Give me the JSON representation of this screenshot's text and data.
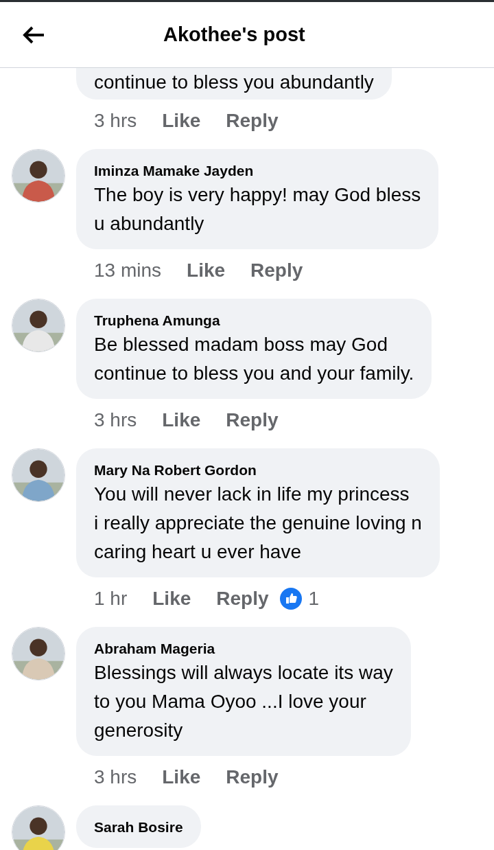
{
  "header": {
    "title": "Akothee's post"
  },
  "comments": [
    {
      "kind": "tail",
      "lines": [
        "continue to bless you abundantly"
      ],
      "time": "3 hrs",
      "like": "Like",
      "reply": "Reply"
    },
    {
      "kind": "full",
      "name": "Iminza Mamake Jayden",
      "lines": [
        "The boy is very happy! may God bless",
        "u abundantly"
      ],
      "time": "13 mins",
      "like": "Like",
      "reply": "Reply"
    },
    {
      "kind": "full",
      "name": "Truphena Amunga",
      "lines": [
        "Be blessed madam boss may God",
        "continue to bless you and your family."
      ],
      "time": "3 hrs",
      "like": "Like",
      "reply": "Reply"
    },
    {
      "kind": "full",
      "name": "Mary Na Robert Gordon",
      "lines": [
        "You will never lack in life my princess",
        "i really appreciate the genuine loving n",
        "caring heart u ever have"
      ],
      "time": "1 hr",
      "like": "Like",
      "reply": "Reply",
      "reactions": "1"
    },
    {
      "kind": "full",
      "name": "Abraham Mageria",
      "lines": [
        "Blessings will always locate its way",
        "to you Mama Oyoo ...I love your",
        "generosity"
      ],
      "time": "3 hrs",
      "like": "Like",
      "reply": "Reply"
    },
    {
      "kind": "head",
      "name": "Sarah Bosire"
    }
  ]
}
